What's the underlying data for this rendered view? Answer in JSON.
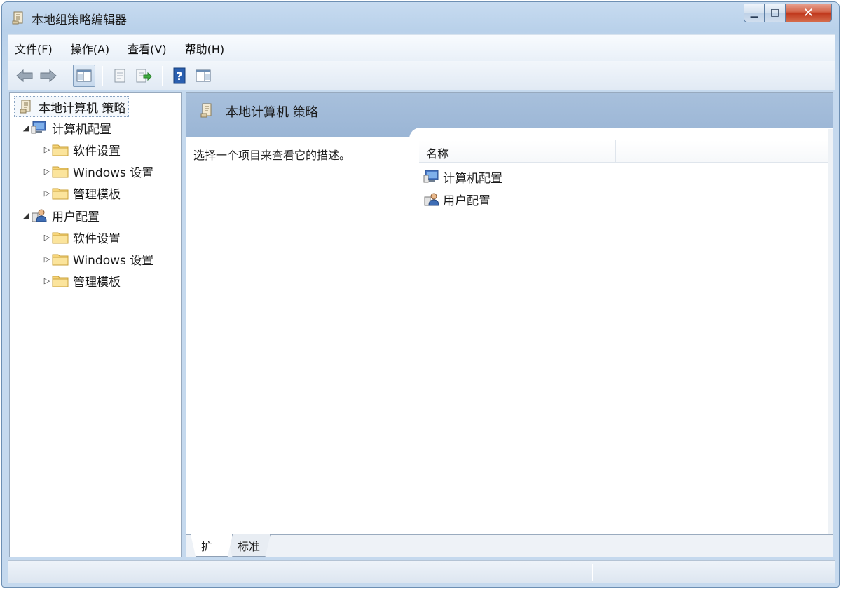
{
  "window": {
    "title": "本地组策略编辑器",
    "controls": {
      "minimize": "▁",
      "maximize": "□",
      "close": "✕"
    }
  },
  "menu": [
    "文件(F)",
    "操作(A)",
    "查看(V)",
    "帮助(H)"
  ],
  "toolbar": {
    "buttons": [
      "back-icon",
      "forward-icon",
      "show-hide-tree-icon",
      "properties-icon",
      "export-list-icon",
      "help-icon",
      "show-hide-action-pane-icon"
    ]
  },
  "tree": {
    "root": "本地计算机 策略",
    "computer": {
      "label": "计算机配置",
      "children": [
        "软件设置",
        "Windows 设置",
        "管理模板"
      ]
    },
    "user": {
      "label": "用户配置",
      "children": [
        "软件设置",
        "Windows 设置",
        "管理模板"
      ]
    }
  },
  "content": {
    "header_title": "本地计算机 策略",
    "description": "选择一个项目来查看它的描述。",
    "column_name": "名称",
    "items": [
      "计算机配置",
      "用户配置"
    ]
  },
  "tabs": [
    "扩展",
    "标准"
  ],
  "colors": {
    "accent": "#9ab5d5",
    "frame": "#c5d9ee",
    "folder": "#f2c94c"
  }
}
